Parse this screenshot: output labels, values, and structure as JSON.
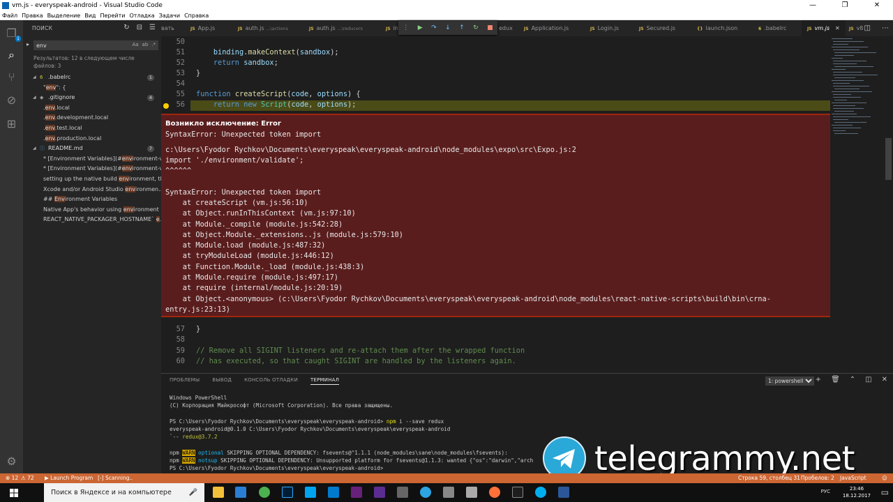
{
  "window": {
    "title": "vm.js - everyspeak-android - Visual Studio Code",
    "buttons": [
      "—",
      "❐",
      "✕"
    ]
  },
  "menu": [
    "Файл",
    "Правка",
    "Выделение",
    "Вид",
    "Перейти",
    "Отладка",
    "Задачи",
    "Справка"
  ],
  "activity": {
    "search_badge": "1"
  },
  "sidebar": {
    "title": "ПОИСК",
    "search_value": "env",
    "search_opts": [
      "Aa",
      "ab",
      ".*"
    ],
    "results_summary": "Результатов: 12 в следующем числе файлов: 3",
    "files": [
      {
        "name": ".babelrc",
        "count": "1",
        "icon": "6",
        "matches": [
          {
            "pre": "\"",
            "hl": "env",
            "post": "\": {"
          }
        ]
      },
      {
        "name": ".gitignore",
        "count": "4",
        "icon": "◆",
        "matches": [
          {
            "pre": ".",
            "hl": "env",
            "post": ".local"
          },
          {
            "pre": ".",
            "hl": "env",
            "post": ".development.local"
          },
          {
            "pre": ".",
            "hl": "env",
            "post": ".test.local"
          },
          {
            "pre": ".",
            "hl": "env",
            "post": ".production.local"
          }
        ]
      },
      {
        "name": "README.md",
        "count": "7",
        "icon": "ⓘ",
        "matches": [
          {
            "pre": "* [Environment Variables](#",
            "hl": "env",
            "post": "ironment-v..."
          },
          {
            "pre": "* [Environment Variables](#",
            "hl": "env",
            "post": "ironment-v..."
          },
          {
            "pre": "setting up the native build ",
            "hl": "env",
            "post": "ironment, th..."
          },
          {
            "pre": "Xcode and/or Android Studio ",
            "hl": "env",
            "post": "ironmen..."
          },
          {
            "pre": "## ",
            "hl": "Env",
            "post": "ironment Variables"
          },
          {
            "pre": "Native App's behavior using ",
            "hl": "env",
            "post": "ironment ..."
          },
          {
            "pre": "REACT_NATIVE_PACKAGER_HOSTNAME` ",
            "hl": "e",
            "post": "..."
          }
        ]
      }
    ]
  },
  "tabs": [
    {
      "label": "вать",
      "sub": ""
    },
    {
      "label": "App.js",
      "sub": ""
    },
    {
      "label": "auth.js",
      "sub": "...\\actions"
    },
    {
      "label": "auth.js",
      "sub": "...\\reducers"
    },
    {
      "label": "in",
      "sub": ""
    },
    {
      "label": "",
      "sub": "edux"
    },
    {
      "label": "Application.js",
      "sub": ""
    },
    {
      "label": "Login.js",
      "sub": ""
    },
    {
      "label": "Secured.js",
      "sub": ""
    },
    {
      "label": "launch.json",
      "sub": ""
    },
    {
      "label": ".babelrc",
      "sub": ""
    },
    {
      "label": "vm.js",
      "sub": ""
    },
    {
      "label": "v8",
      "sub": ""
    }
  ],
  "code_top": [
    {
      "ln": "50",
      "text": ""
    },
    {
      "ln": "51",
      "text": "    binding.makeContext(sandbox);"
    },
    {
      "ln": "52",
      "text": "    return sandbox;"
    },
    {
      "ln": "53",
      "text": "}"
    },
    {
      "ln": "54",
      "text": ""
    },
    {
      "ln": "55",
      "text": "function createScript(code, options) {"
    },
    {
      "ln": "56",
      "text": "    return new Script(code, options);"
    }
  ],
  "exception": {
    "title": "Возникло исключение: Error",
    "lines": [
      "SyntaxError: Unexpected token import",
      "",
      "c:\\Users\\Fyodor Rychkov\\Documents\\everyspeak\\everyspeak-android\\node_modules\\expo\\src\\Expo.js:2",
      "import './environment/validate';",
      "^^^^^^",
      "",
      "SyntaxError: Unexpected token import",
      "    at createScript (vm.js:56:10)",
      "    at Object.runInThisContext (vm.js:97:10)",
      "    at Module._compile (module.js:542:28)",
      "    at Object.Module._extensions..js (module.js:579:10)",
      "    at Module.load (module.js:487:32)",
      "    at tryModuleLoad (module.js:446:12)",
      "    at Function.Module._load (module.js:438:3)",
      "    at Module.require (module.js:497:17)",
      "    at require (internal/module.js:20:19)",
      "    at Object.<anonymous> (c:\\Users\\Fyodor Rychkov\\Documents\\everyspeak\\everyspeak-android\\node_modules\\react-native-scripts\\build\\bin\\crna-",
      "entry.js:23:13)"
    ]
  },
  "code_bottom": [
    {
      "ln": "57",
      "text": "}"
    },
    {
      "ln": "58",
      "text": ""
    },
    {
      "ln": "59",
      "text": "// Remove all SIGINT listeners and re-attach them after the wrapped function"
    },
    {
      "ln": "60",
      "text": "// has executed, so that caught SIGINT are handled by the listeners again."
    }
  ],
  "panel": {
    "tabs": [
      "ПРОБЛЕМЫ",
      "ВЫВОД",
      "КОНСОЛЬ ОТЛАДКИ",
      "ТЕРМИНАЛ"
    ],
    "terminal_select": "1: powershell",
    "terminal": [
      "Windows PowerShell",
      "(C) Корпорация Майкрософт (Microsoft Corporation). Все права защищены.",
      "",
      "PS C:\\Users\\Fyodor Rychkov\\Documents\\everyspeak\\everyspeak-android> npm i --save redux",
      "everyspeak-android@0.1.0 C:\\Users\\Fyodor Rychkov\\Documents\\everyspeak\\everyspeak-android",
      "`-- redux@3.7.2",
      "",
      "npm WARN optional SKIPPING OPTIONAL DEPENDENCY: fsevents@^1.1.1 (node_modules\\sane\\node_modules\\fsevents):",
      "npm WARN notsup SKIPPING OPTIONAL DEPENDENCY: Unsupported platform for fsevents@1.1.3: wanted {\"os\":\"darwin\",\"arch",
      "PS C:\\Users\\Fyodor Rychkov\\Documents\\everyspeak\\everyspeak-android> "
    ]
  },
  "watermark": "telegrammy.net",
  "status": {
    "errors": "⊗ 12",
    "warnings": "⚠ 72",
    "launch": "▶ Launch Program",
    "scanning": "[-] Scanning..",
    "position": "Строка 59, столбец 31",
    "spaces": "Пробелов: 2",
    "language": "JavaScript"
  },
  "taskbar": {
    "search_placeholder": "Поиск в Яндексе и на компьютере",
    "lang": "РУС",
    "time": "23:46",
    "date": "18.12.2017"
  },
  "colors": {
    "accent": "#007acc",
    "statusbar": "#cc6633",
    "exception_bg": "#5a1d1d"
  }
}
